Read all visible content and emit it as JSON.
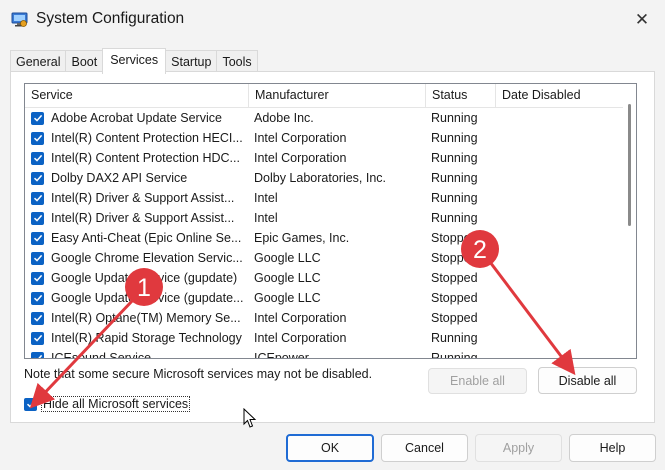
{
  "window": {
    "title": "System Configuration",
    "close_glyph": "✕"
  },
  "tabs": [
    {
      "label": "General"
    },
    {
      "label": "Boot"
    },
    {
      "label": "Services",
      "active": true
    },
    {
      "label": "Startup"
    },
    {
      "label": "Tools"
    }
  ],
  "services": {
    "columns": [
      "Service",
      "Manufacturer",
      "Status",
      "Date Disabled"
    ],
    "rows": [
      {
        "service": "Adobe Acrobat Update Service",
        "manufacturer": "Adobe Inc.",
        "status": "Running",
        "date_disabled": ""
      },
      {
        "service": "Intel(R) Content Protection HECI...",
        "manufacturer": "Intel Corporation",
        "status": "Running",
        "date_disabled": ""
      },
      {
        "service": "Intel(R) Content Protection HDC...",
        "manufacturer": "Intel Corporation",
        "status": "Running",
        "date_disabled": ""
      },
      {
        "service": "Dolby DAX2 API Service",
        "manufacturer": "Dolby Laboratories, Inc.",
        "status": "Running",
        "date_disabled": ""
      },
      {
        "service": "Intel(R) Driver & Support Assist...",
        "manufacturer": "Intel",
        "status": "Running",
        "date_disabled": ""
      },
      {
        "service": "Intel(R) Driver & Support Assist...",
        "manufacturer": "Intel",
        "status": "Running",
        "date_disabled": ""
      },
      {
        "service": "Easy Anti-Cheat (Epic Online Se...",
        "manufacturer": "Epic Games, Inc.",
        "status": "Stopped",
        "date_disabled": ""
      },
      {
        "service": "Google Chrome Elevation Servic...",
        "manufacturer": "Google LLC",
        "status": "Stopped",
        "date_disabled": ""
      },
      {
        "service": "Google Update Service (gupdate)",
        "manufacturer": "Google LLC",
        "status": "Stopped",
        "date_disabled": ""
      },
      {
        "service": "Google Update Service (gupdate...",
        "manufacturer": "Google LLC",
        "status": "Stopped",
        "date_disabled": ""
      },
      {
        "service": "Intel(R) Optane(TM) Memory Se...",
        "manufacturer": "Intel Corporation",
        "status": "Stopped",
        "date_disabled": ""
      },
      {
        "service": "Intel(R) Rapid Storage Technology",
        "manufacturer": "Intel Corporation",
        "status": "Running",
        "date_disabled": ""
      },
      {
        "service": "ICEsound Service",
        "manufacturer": "ICEpower",
        "status": "Running",
        "date_disabled": ""
      }
    ]
  },
  "note": "Note that some secure Microsoft services may not be disabled.",
  "buttons": {
    "enable_all": "Enable all",
    "disable_all": "Disable all",
    "ok": "OK",
    "cancel": "Cancel",
    "apply": "Apply",
    "help": "Help"
  },
  "hide_ms": {
    "label": "Hide all Microsoft services",
    "checked": true
  },
  "annotations": {
    "marker_1": "1",
    "marker_2": "2",
    "color": "#e0393e"
  },
  "colors": {
    "accent": "#0b62c4"
  }
}
